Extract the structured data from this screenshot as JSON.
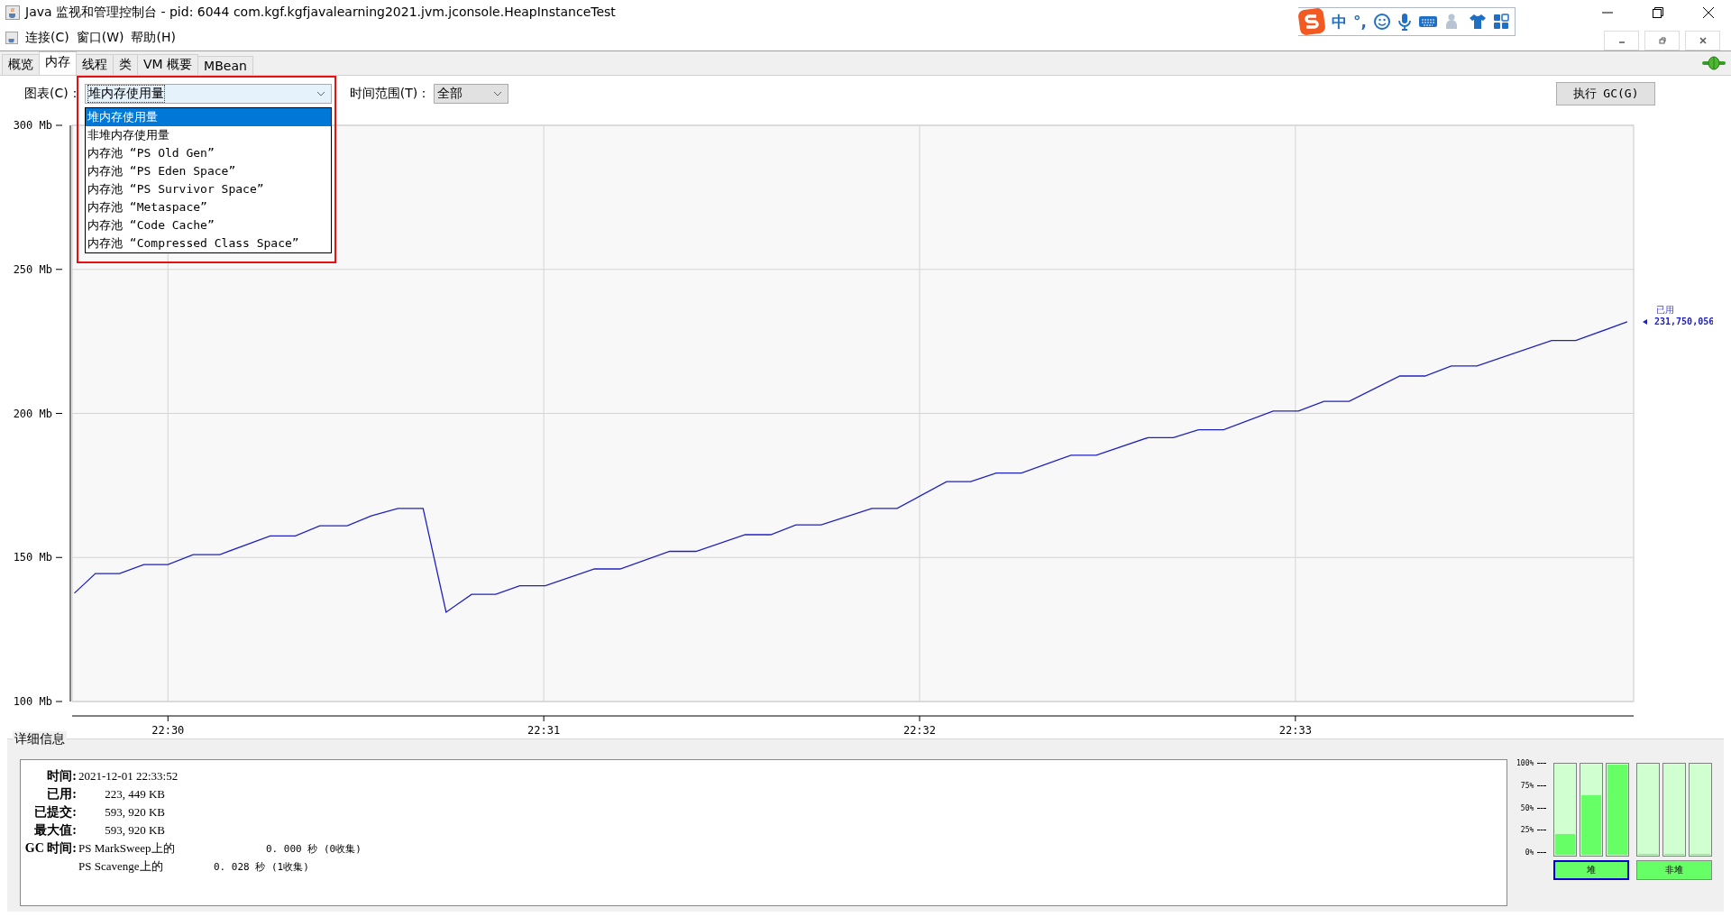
{
  "window": {
    "title": "Java 监视和管理控制台 - pid: 6044 com.kgf.kgfjavalearning2021.jvm.jconsole.HeapInstanceTest"
  },
  "ime": {
    "mode": "中",
    "punctuation": "°,"
  },
  "menu": [
    {
      "label": "连接(C)"
    },
    {
      "label": "窗口(W)"
    },
    {
      "label": "帮助(H)"
    }
  ],
  "tabs": [
    {
      "label": "概览",
      "selected": false
    },
    {
      "label": "内存",
      "selected": true
    },
    {
      "label": "线程",
      "selected": false
    },
    {
      "label": "类",
      "selected": false
    },
    {
      "label": "VM 概要",
      "selected": false
    },
    {
      "label": "MBean",
      "selected": false
    }
  ],
  "chart_selector": {
    "label": "图表(C)：",
    "value": "堆内存使用量",
    "options": [
      {
        "label": "堆内存使用量",
        "selected": true
      },
      {
        "label": "非堆内存使用量",
        "selected": false
      },
      {
        "label": "内存池 “PS Old Gen”",
        "selected": false
      },
      {
        "label": "内存池 “PS Eden Space”",
        "selected": false
      },
      {
        "label": "内存池 “PS Survivor Space”",
        "selected": false
      },
      {
        "label": "内存池 “Metaspace”",
        "selected": false
      },
      {
        "label": "内存池 “Code Cache”",
        "selected": false
      },
      {
        "label": "内存池 “Compressed Class Space”",
        "selected": false
      }
    ]
  },
  "time_range": {
    "label": "时间范围(T)：",
    "value": "全部"
  },
  "gc_button": {
    "label": "执行 GC(G)"
  },
  "memory_chart": {
    "marker_value": "231,750,056",
    "chart_data": {
      "type": "line",
      "x": [
        1349.751,
        1349.807,
        1349.871,
        1349.936,
        1350,
        1350.067,
        1350.138,
        1350.272,
        1350.339,
        1350.404,
        1350.477,
        1350.541,
        1350.612,
        1350.679,
        1350.74,
        1350.808,
        1350.872,
        1350.936,
        1351.004,
        1351.135,
        1351.203,
        1351.335,
        1351.405,
        1351.536,
        1351.604,
        1351.671,
        1351.738,
        1351.873,
        1351.94,
        1352.072,
        1352.136,
        1352.204,
        1352.271,
        1352.403,
        1352.47,
        1352.608,
        1352.675,
        1352.742,
        1352.809,
        1352.941,
        1353.008,
        1353.076,
        1353.143,
        1353.278,
        1353.345,
        1353.415,
        1353.483,
        1353.682,
        1353.746,
        1353.883
      ],
      "series": [
        {
          "name": "已用",
          "color": "#2020c0",
          "values": [
            137.6,
            144.4,
            144.4,
            147.5,
            147.5,
            151,
            151,
            157.5,
            157.5,
            161,
            161,
            164.4,
            167,
            167,
            131,
            137.2,
            137.2,
            140.2,
            140.2,
            146,
            146,
            152.1,
            152.1,
            157.9,
            157.9,
            161.3,
            161.3,
            167,
            167,
            176.3,
            176.3,
            179.3,
            179.3,
            185.5,
            185.5,
            191.6,
            191.6,
            194.3,
            194.3,
            200.8,
            200.8,
            204.2,
            204.2,
            213,
            213,
            216.5,
            216.5,
            225.3,
            225.3,
            231.8
          ]
        }
      ],
      "xlim": [
        1349.745,
        1353.9
      ],
      "ylim": [
        100,
        300
      ],
      "grid": true,
      "xticks": [
        {
          "value": 1350,
          "label": "22:30"
        },
        {
          "value": 1351,
          "label": "22:31"
        },
        {
          "value": 1352,
          "label": "22:32"
        },
        {
          "value": 1353,
          "label": "22:33"
        }
      ],
      "yticks": [
        {
          "value": 100,
          "label": "100 Mb"
        },
        {
          "value": 150,
          "label": "150 Mb"
        },
        {
          "value": 200,
          "label": "200 Mb"
        },
        {
          "value": 250,
          "label": "250 Mb"
        },
        {
          "value": 300,
          "label": "300 Mb"
        }
      ]
    }
  },
  "details": {
    "title": "详细信息",
    "rows": [
      {
        "label": "时间:",
        "value": "2021-12-01 22:33:52",
        "kind": "date"
      },
      {
        "label": "已用:",
        "value": "223, 449 KB",
        "kind": "size"
      },
      {
        "label": "已提交:",
        "value": "593, 920 KB",
        "kind": "size"
      },
      {
        "label": "最大值:",
        "value": "593, 920 KB",
        "kind": "size"
      }
    ],
    "gc": [
      {
        "label": "GC 时间:",
        "collector": "PS MarkSweep上的",
        "time": "0. 000  秒 (0收集)"
      },
      {
        "collector": "PS Scavenge上的",
        "time": "0. 028  秒 (1收集)"
      }
    ]
  },
  "usage_bars": {
    "ticks": [
      "100%",
      "75%",
      "50%",
      "25%",
      "0%"
    ],
    "groups": [
      {
        "label": "堆",
        "selected": true,
        "bars": [
          {
            "level": 0.23
          },
          {
            "level": 0.66
          },
          {
            "level": 1
          }
        ]
      },
      {
        "label": "非堆",
        "selected": false,
        "bars": [
          {
            "level": 0
          },
          {
            "level": 0.01
          },
          {
            "level": 0
          }
        ]
      }
    ]
  }
}
